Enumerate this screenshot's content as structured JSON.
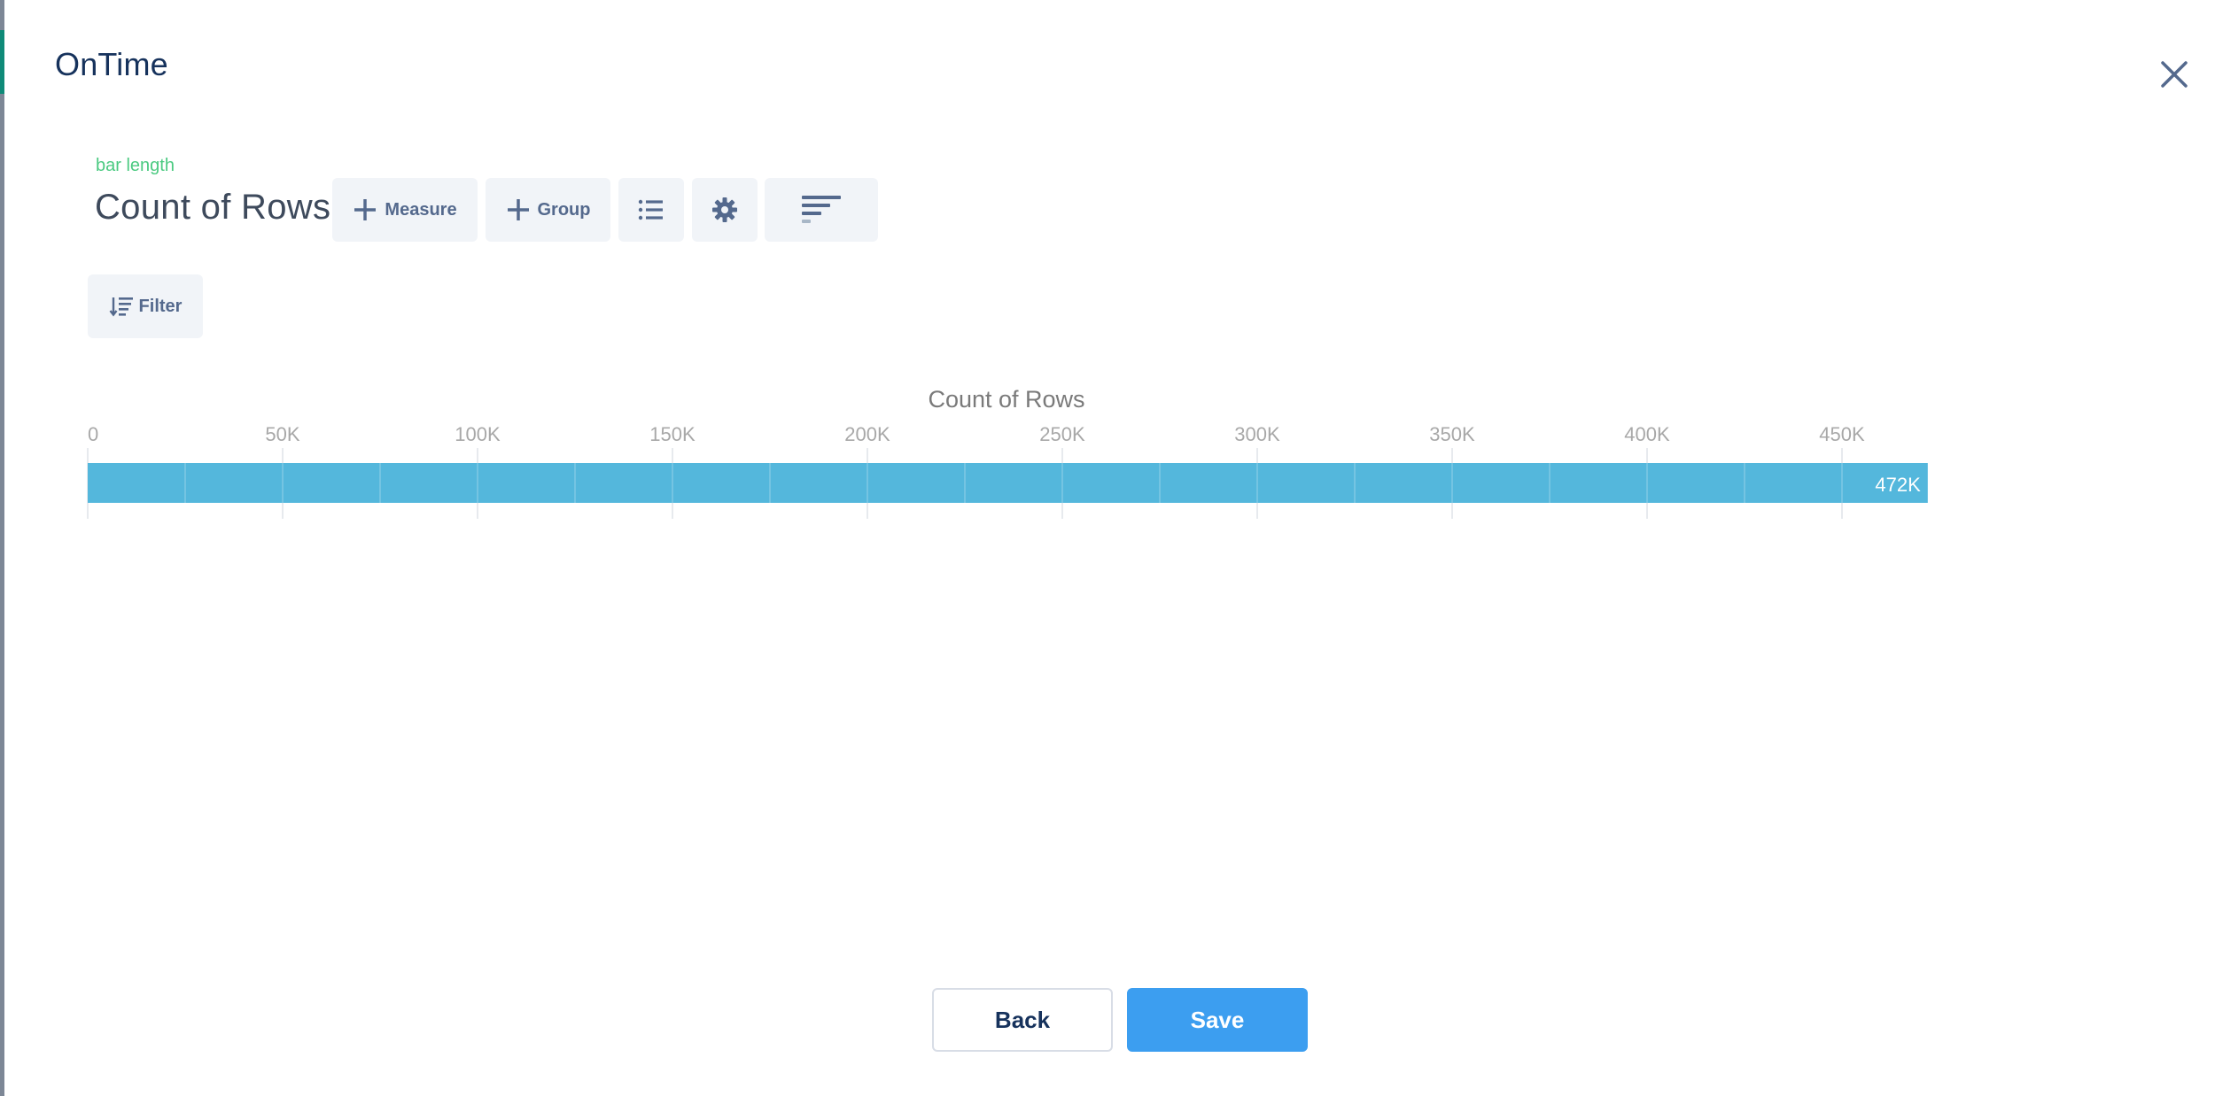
{
  "modal": {
    "title": "OnTime",
    "close_icon": "close-icon"
  },
  "query": {
    "bar_length_label": "bar length",
    "measure_title": "Count of Rows"
  },
  "toolbar": {
    "measure_label": "Measure",
    "group_label": "Group",
    "icons": [
      "plus-icon",
      "plus-icon",
      "list-icon",
      "gear-icon",
      "bar-chart-icon"
    ]
  },
  "filter": {
    "label": "Filter",
    "icon": "filter-icon"
  },
  "chart_data": {
    "type": "bar",
    "orientation": "horizontal",
    "title": "Count of Rows",
    "categories": [
      ""
    ],
    "values": [
      472000
    ],
    "data_labels": [
      "472K"
    ],
    "xlim": [
      0,
      472000
    ],
    "major_ticks": [
      0,
      50000,
      100000,
      150000,
      200000,
      250000,
      300000,
      350000,
      400000,
      450000
    ],
    "tick_labels": [
      "0",
      "50K",
      "100K",
      "150K",
      "200K",
      "250K",
      "300K",
      "350K",
      "400K",
      "450K"
    ],
    "minor_ticks": [
      25000,
      75000,
      125000,
      175000,
      225000,
      275000,
      325000,
      375000,
      425000
    ],
    "grid": true,
    "bar_color": "#54b7dc"
  },
  "footer": {
    "back_label": "Back",
    "save_label": "Save"
  },
  "colors": {
    "primary": "#3c9ef0",
    "accent_green": "#4bca81",
    "text_dark": "#16325c",
    "button_bg": "#f1f4f8"
  }
}
